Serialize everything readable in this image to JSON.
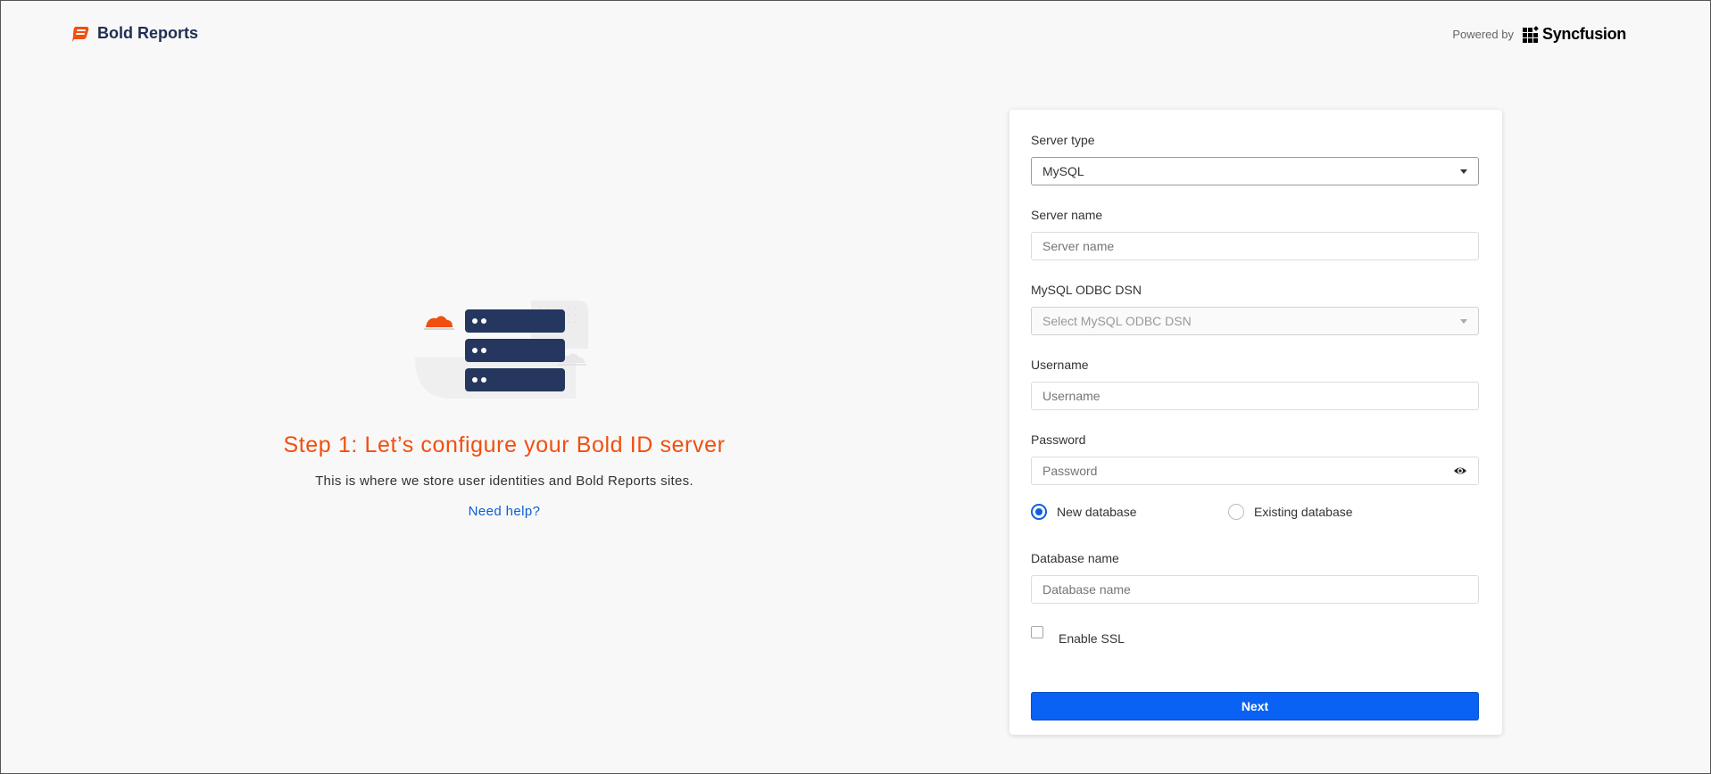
{
  "header": {
    "brand": "Bold Reports",
    "powered_by": "Powered by",
    "partner": "Syncfusion"
  },
  "intro": {
    "title": "Step 1: Let’s configure your Bold ID server",
    "description": "This is where we store user identities and Bold Reports sites.",
    "help_link": "Need help?"
  },
  "form": {
    "server_type": {
      "label": "Server type",
      "value": "MySQL"
    },
    "server_name": {
      "label": "Server name",
      "placeholder": "Server name",
      "value": ""
    },
    "odbc_dsn": {
      "label": "MySQL ODBC DSN",
      "placeholder": "Select MySQL ODBC DSN"
    },
    "username": {
      "label": "Username",
      "placeholder": "Username",
      "value": ""
    },
    "password": {
      "label": "Password",
      "placeholder": "Password",
      "value": ""
    },
    "database_mode": {
      "options": [
        "New database",
        "Existing database"
      ],
      "selected": "New database"
    },
    "database_name": {
      "label": "Database name",
      "placeholder": "Database name",
      "value": ""
    },
    "enable_ssl": {
      "label": "Enable SSL",
      "checked": false
    },
    "submit_label": "Next"
  },
  "colors": {
    "accent_orange": "#f04f0f",
    "primary_blue": "#0a62f5",
    "link_blue": "#0a5ed7",
    "navy": "#1f2f52"
  },
  "icons": {
    "brand": "bold-reports-logo-icon",
    "partner": "syncfusion-logo-icon",
    "hero": "server-illustration",
    "dropdown": "caret-down-icon",
    "password_toggle": "eye-icon"
  }
}
